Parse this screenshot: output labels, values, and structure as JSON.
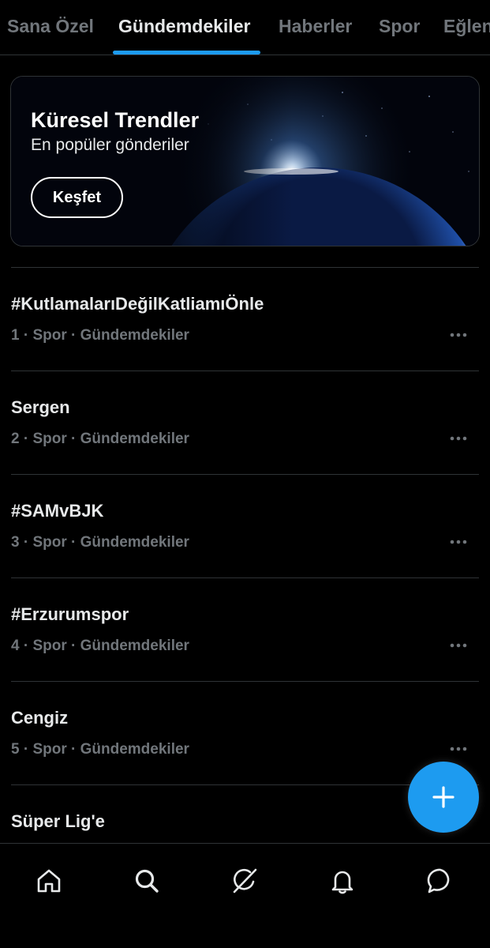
{
  "tabs": [
    {
      "label": "Sana Özel",
      "active": false
    },
    {
      "label": "Gündemdekiler",
      "active": true
    },
    {
      "label": "Haberler",
      "active": false
    },
    {
      "label": "Spor",
      "active": false
    },
    {
      "label": "Eğlen",
      "active": false
    }
  ],
  "banner": {
    "title": "Küresel Trendler",
    "subtitle": "En popüler gönderiler",
    "button_label": "Keşfet"
  },
  "trends": [
    {
      "name": "#KutlamalarıDeğilKatliamıÖnle",
      "meta": "1 · Spor · Gündemdekiler"
    },
    {
      "name": "Sergen",
      "meta": "2 · Spor · Gündemdekiler"
    },
    {
      "name": "#SAMvBJK",
      "meta": "3 · Spor · Gündemdekiler"
    },
    {
      "name": "#Erzurumspor",
      "meta": "4 · Spor · Gündemdekiler"
    },
    {
      "name": "Cengiz",
      "meta": "5 · Spor · Gündemdekiler"
    },
    {
      "name": "Süper Lig'e",
      "meta": ""
    }
  ],
  "fab": {
    "icon": "plus-icon"
  },
  "bottom_nav": [
    {
      "icon": "home-icon"
    },
    {
      "icon": "search-icon"
    },
    {
      "icon": "grok-icon"
    },
    {
      "icon": "bell-icon"
    },
    {
      "icon": "messages-icon"
    }
  ],
  "colors": {
    "accent": "#1d9bf0",
    "background": "#000000",
    "muted_text": "#71767b",
    "divider": "#2f3336"
  }
}
